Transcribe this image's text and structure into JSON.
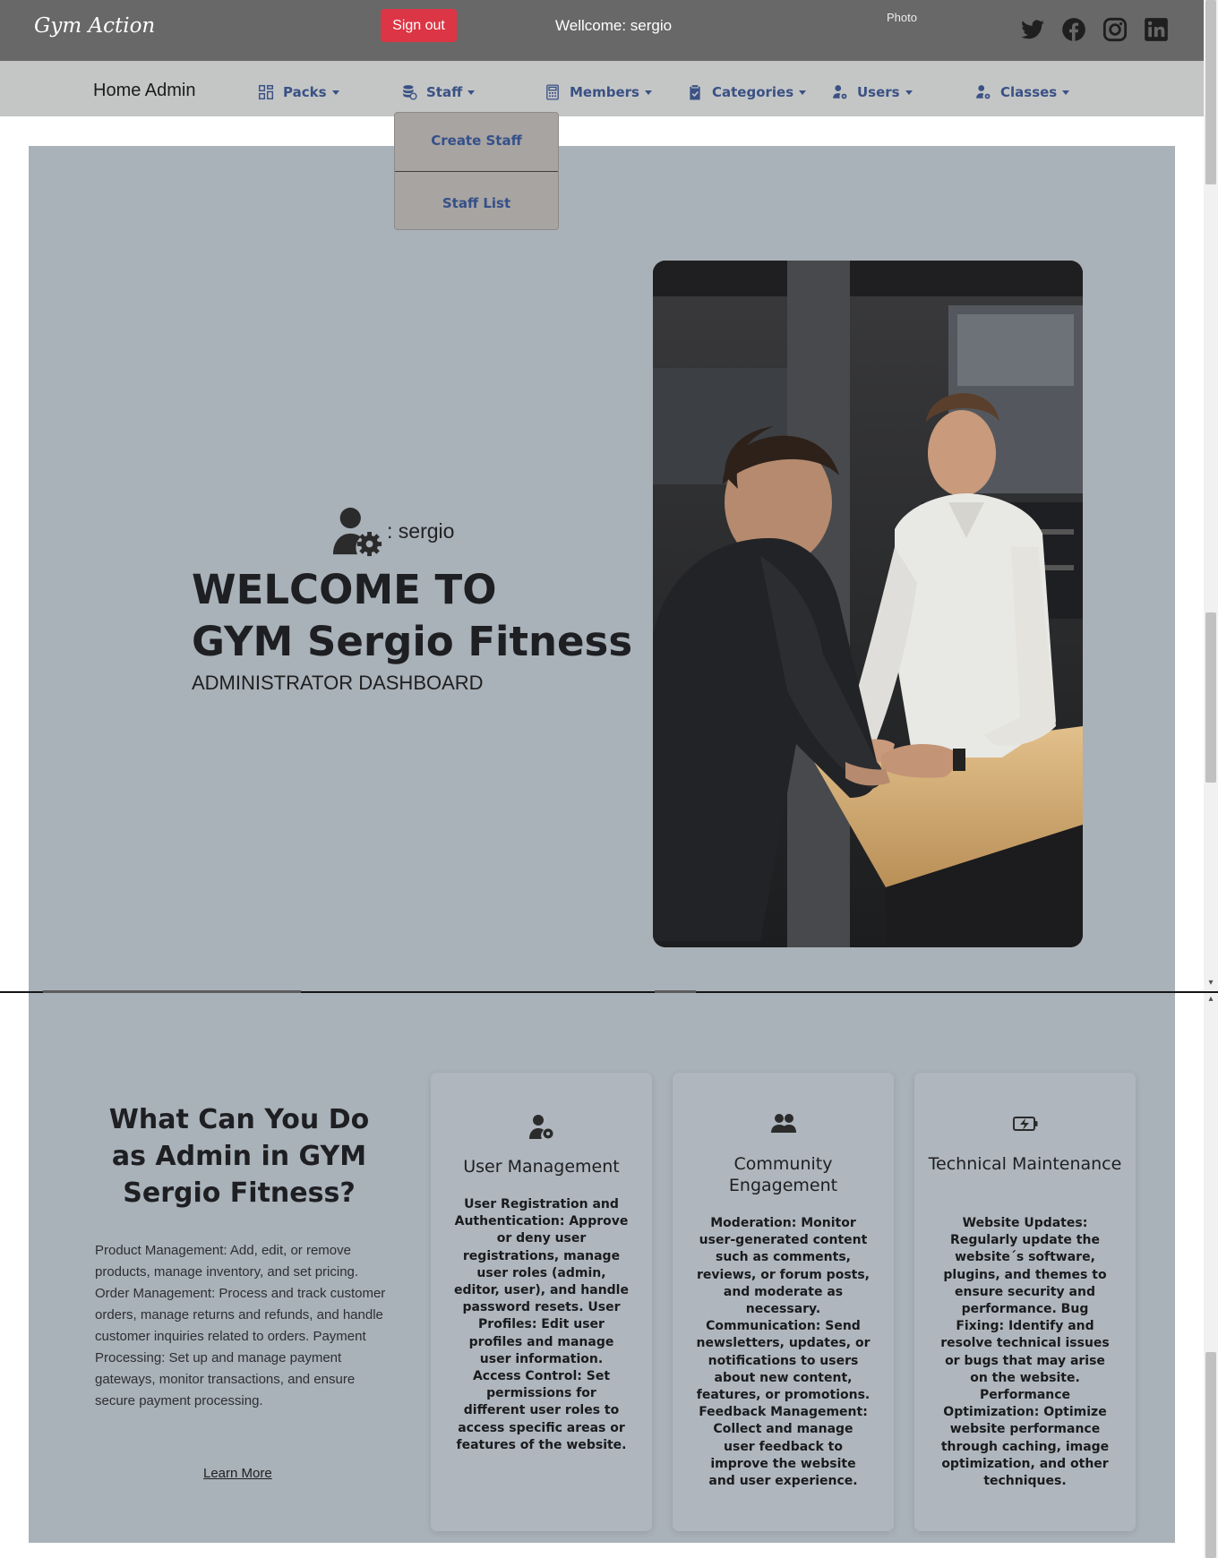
{
  "topbar": {
    "brand": "Gym Action",
    "signout_label": "Sign out",
    "welcome": "Wellcome: sergio",
    "photo_label": "Photo",
    "signout_color": "#dc3545",
    "social_icons": [
      "twitter-icon",
      "facebook-icon",
      "instagram-icon",
      "linkedin-icon"
    ]
  },
  "nav": {
    "home": "Home Admin",
    "items": [
      {
        "label": "Packs",
        "icon": "grid-icon"
      },
      {
        "label": "Staff",
        "icon": "database-icon"
      },
      {
        "label": "Members",
        "icon": "calculator-icon"
      },
      {
        "label": "Categories",
        "icon": "clipboard-icon"
      },
      {
        "label": "Users",
        "icon": "user-gear-icon"
      },
      {
        "label": "Classes",
        "icon": "user-gear-icon"
      }
    ]
  },
  "staff_dropdown": {
    "items": [
      "Create Staff",
      "Staff List"
    ]
  },
  "hero": {
    "username": ": sergio",
    "title_line1": "WELCOME TO",
    "title_line2": "GYM Sergio Fitness",
    "subtitle": "ADMINISTRATOR DASHBOARD"
  },
  "features": {
    "title": "What Can You Do as Admin in GYM Sergio Fitness?",
    "body": "Product Management: Add, edit, or remove products, manage inventory, and set pricing. Order Management: Process and track customer orders, manage returns and refunds, and handle customer inquiries related to orders. Payment Processing: Set up and manage payment gateways, monitor transactions, and ensure secure payment processing.",
    "learn_more": "Learn More"
  },
  "cards": [
    {
      "icon": "user-gear-icon",
      "title": "User Management",
      "text": "User Registration and Authentication: Approve or deny user registrations, manage user roles (admin, editor, user), and handle password resets. User Profiles: Edit user profiles and manage user information. Access Control: Set permissions for different user roles to access specific areas or features of the website."
    },
    {
      "icon": "people-icon",
      "title": "Community Engagement",
      "text": "Moderation: Monitor user-generated content such as comments, reviews, or forum posts, and moderate as necessary. Communication: Send newsletters, updates, or notifications to users about new content, features, or promotions. Feedback Management: Collect and manage user feedback to improve the website and user experience."
    },
    {
      "icon": "battery-charging-icon",
      "title": "Technical Maintenance",
      "text": "Website Updates: Regularly update the website´s software, plugins, and themes to ensure security and performance. Bug Fixing: Identify and resolve technical issues or bugs that may arise on the website. Performance Optimization: Optimize website performance through caching, image optimization, and other techniques."
    }
  ],
  "colors": {
    "topbar": "#686868",
    "navbar": "#c4c6c6",
    "panel": "#a9b1b9",
    "nav_link": "#3a5184"
  }
}
